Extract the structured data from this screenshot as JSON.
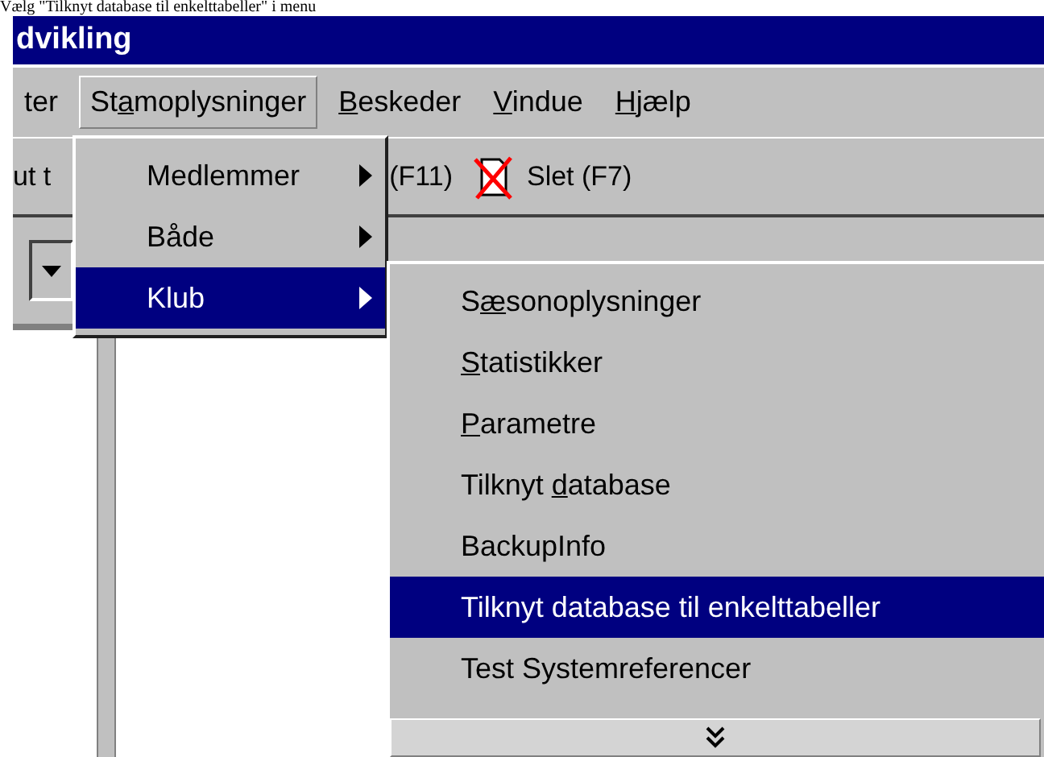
{
  "caption": "Vælg \"Tilknyt database til enkelttabeller\" i menu",
  "window": {
    "title": "dvikling"
  },
  "menu_bar": [
    {
      "label": "ter",
      "selected": false
    },
    {
      "accel": {
        "before": "St",
        "key": "a",
        "after": "moplysninger"
      },
      "selected": true
    },
    {
      "accel": {
        "key": "B",
        "after": "eskeder"
      },
      "selected": false
    },
    {
      "accel": {
        "key": "V",
        "after": "indue"
      },
      "selected": false
    },
    {
      "accel": {
        "key": "H",
        "after": "jælp"
      },
      "selected": false
    }
  ],
  "toolbar": [
    {
      "kind": "text",
      "label": "ut t"
    },
    {
      "kind": "text",
      "label": "(F11)"
    },
    {
      "kind": "delete",
      "label": "Slet (F7)"
    }
  ],
  "menu": [
    {
      "label": "Medlemmer",
      "selected": false,
      "has_submenu": true
    },
    {
      "label": "Både",
      "selected": false,
      "has_submenu": true
    },
    {
      "label": "Klub",
      "selected": true,
      "has_submenu": true
    }
  ],
  "submenu": [
    {
      "accel": {
        "before": "S",
        "key": "æ",
        "after": "sonoplysninger"
      },
      "selected": false
    },
    {
      "accel": {
        "key": "S",
        "after": "tatistikker"
      },
      "selected": false
    },
    {
      "accel": {
        "key": "P",
        "after": "arametre"
      },
      "selected": false
    },
    {
      "accel": {
        "before": "Tilknyt ",
        "key": "d",
        "after": "atabase"
      },
      "selected": false
    },
    {
      "label": "BackupInfo",
      "selected": false
    },
    {
      "label": "Tilknyt database til enkelttabeller",
      "selected": true
    },
    {
      "label": "Test Systemreferencer",
      "selected": false
    }
  ]
}
